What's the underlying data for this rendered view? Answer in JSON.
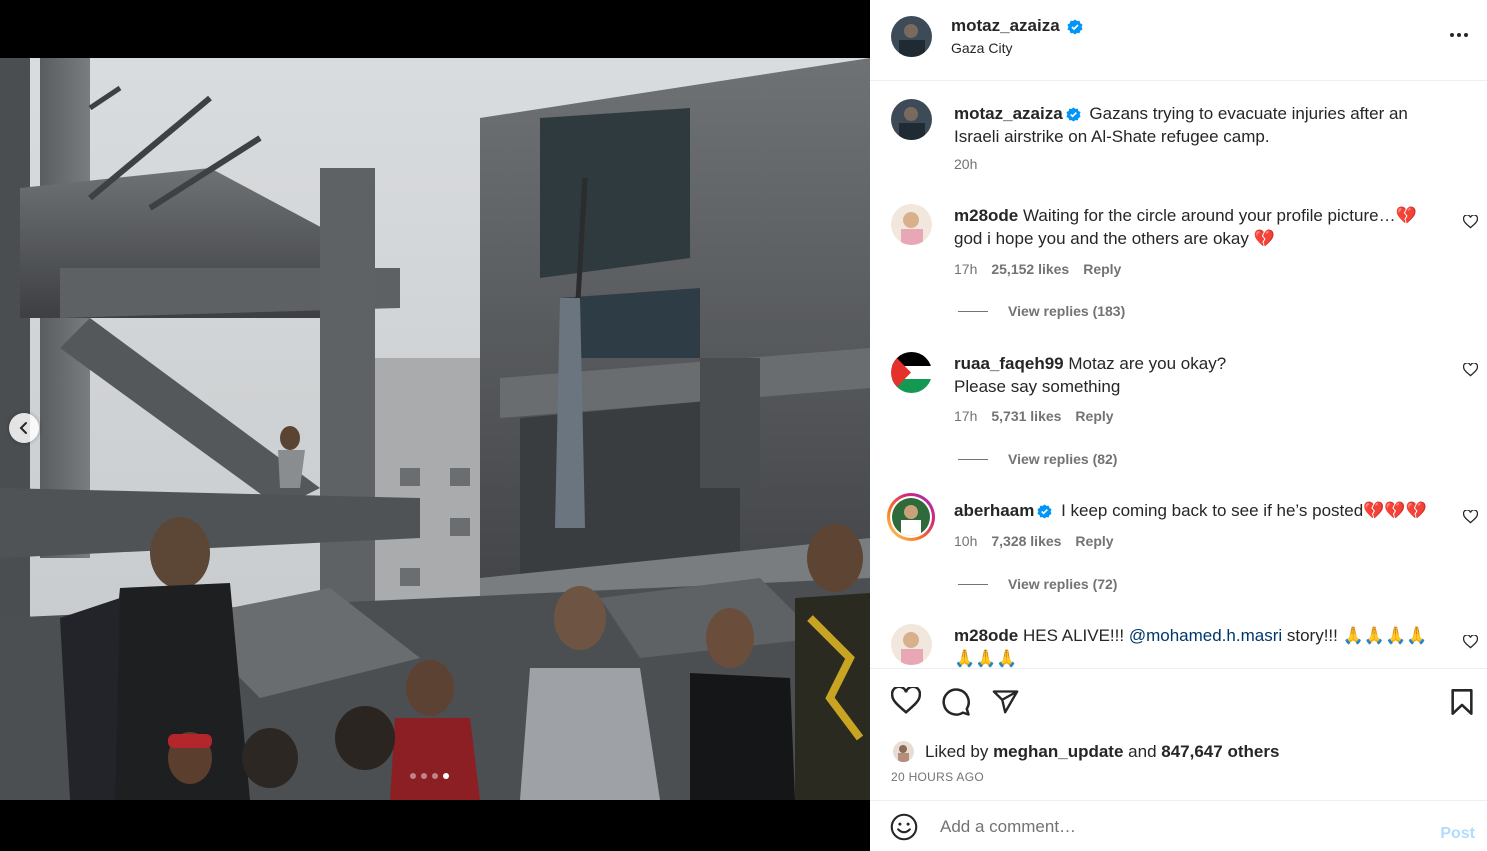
{
  "post": {
    "username": "motaz_azaiza",
    "location": "Gaza City",
    "caption": "Gazans trying to evacuate injuries after an Israeli airstrike on Al-Shate refugee camp.",
    "caption_time": "20h"
  },
  "carousel": {
    "slide_count": 4,
    "active_slide": 4
  },
  "comments": [
    {
      "username": "m28ode",
      "text_line1": "Waiting for the circle around your profile picture…💔",
      "text_line2": "god i hope you and the others are okay 💔",
      "time": "17h",
      "likes": "25,152 likes",
      "reply": "Reply",
      "view_replies": "View replies (183)"
    },
    {
      "username": "ruaa_faqeh99",
      "text_line1": "Motaz are you okay?",
      "text_line2": "Please say something",
      "time": "17h",
      "likes": "5,731 likes",
      "reply": "Reply",
      "view_replies": "View replies (82)"
    },
    {
      "username": "aberhaam",
      "verified": true,
      "text_line1": "I keep coming back to see if he’s posted💔💔💔",
      "time": "10h",
      "likes": "7,328 likes",
      "reply": "Reply",
      "view_replies": "View replies (72)"
    },
    {
      "username": "m28ode",
      "text_prefix": "HES ALIVE!!!",
      "mention": "@mohamed.h.masri",
      "text_suffix": "story!!! 🙏🙏🙏🙏",
      "text_line2": "🙏🙏🙏"
    }
  ],
  "likes_line": {
    "prefix": "Liked by",
    "user": "meghan_update",
    "middle": "and",
    "others": "847,647 others"
  },
  "timestamp": "20 HOURS AGO",
  "add_comment": {
    "placeholder": "Add a comment…",
    "post_label": "Post"
  },
  "icons": {
    "verified": "verified-badge-icon",
    "more": "more-options-icon",
    "like": "heart-icon",
    "comment": "comment-icon",
    "share": "share-icon",
    "save": "bookmark-icon",
    "emoji": "emoji-icon",
    "prev": "chevron-left-icon"
  },
  "colors": {
    "verified_blue": "#0095f6",
    "text": "#262626",
    "secondary": "#737373",
    "mention": "#00376b",
    "post_disabled": "#b3dbff",
    "palestine_flag": [
      "#000000",
      "#ffffff",
      "#149954",
      "#e4312b"
    ]
  }
}
